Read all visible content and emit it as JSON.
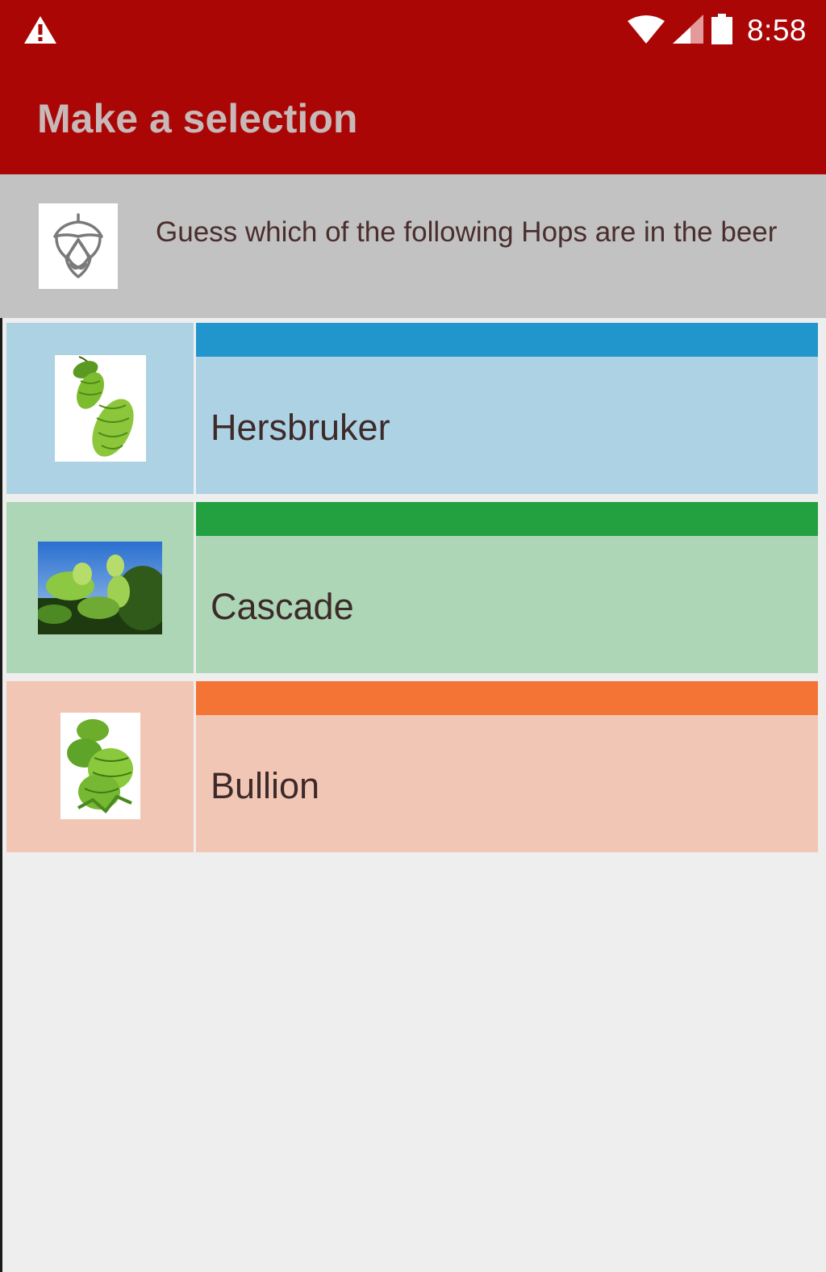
{
  "status_bar": {
    "time": "8:58",
    "icons": [
      "warning-icon",
      "wifi-icon",
      "signal-icon",
      "battery-icon"
    ]
  },
  "app_bar": {
    "title": "Make a selection"
  },
  "header": {
    "icon": "hop-cone-icon",
    "text": "Guess which of the  following Hops are in the beer"
  },
  "options": [
    {
      "label": "Hersbruker",
      "image": "hop-cones-image",
      "stripe_color": "#2196cc",
      "bg_color": "#add2e3"
    },
    {
      "label": "Cascade",
      "image": "hop-plant-photo",
      "stripe_color": "#23a040",
      "bg_color": "#acd6b5"
    },
    {
      "label": "Bullion",
      "image": "hop-cluster-image",
      "stripe_color": "#f37435",
      "bg_color": "#f1c6b4"
    }
  ],
  "colors": {
    "primary": "#aa0606",
    "header_bg": "#c2c2c2",
    "screen_bg": "#eeeeee"
  }
}
